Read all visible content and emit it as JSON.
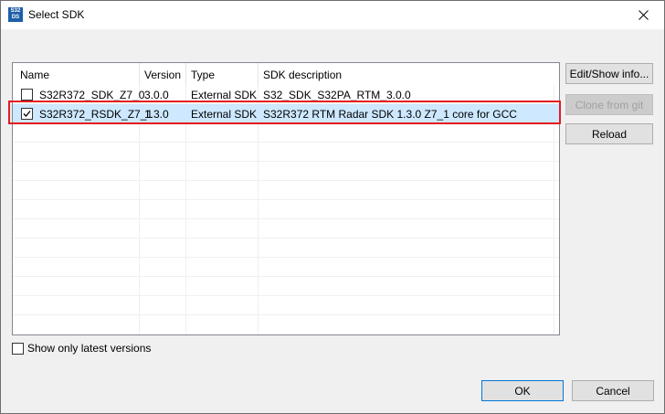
{
  "window": {
    "title": "Select SDK",
    "icon_text": "S32 DS"
  },
  "table": {
    "headers": [
      "Name",
      "Version",
      "Type",
      "SDK description"
    ],
    "rows": [
      {
        "checked": false,
        "name": "S32R372_SDK_Z7_0",
        "version": "3.0.0",
        "type": "External SDK",
        "description": "S32_SDK_S32PA_RTM_3.0.0"
      },
      {
        "checked": true,
        "name": "S32R372_RSDK_Z7_1",
        "version": "1.3.0",
        "type": "External SDK",
        "description": "S32R372 RTM Radar SDK 1.3.0 Z7_1 core for GCC"
      }
    ]
  },
  "buttons": {
    "edit_show_info": "Edit/Show info...",
    "clone_from_git": "Clone from git",
    "reload": "Reload",
    "ok": "OK",
    "cancel": "Cancel"
  },
  "options": {
    "show_latest_label": "Show only latest versions",
    "show_latest_checked": false
  },
  "colors": {
    "selection": "#cde8ff",
    "highlight_border": "#e31b23",
    "default_button_border": "#0078d7"
  }
}
